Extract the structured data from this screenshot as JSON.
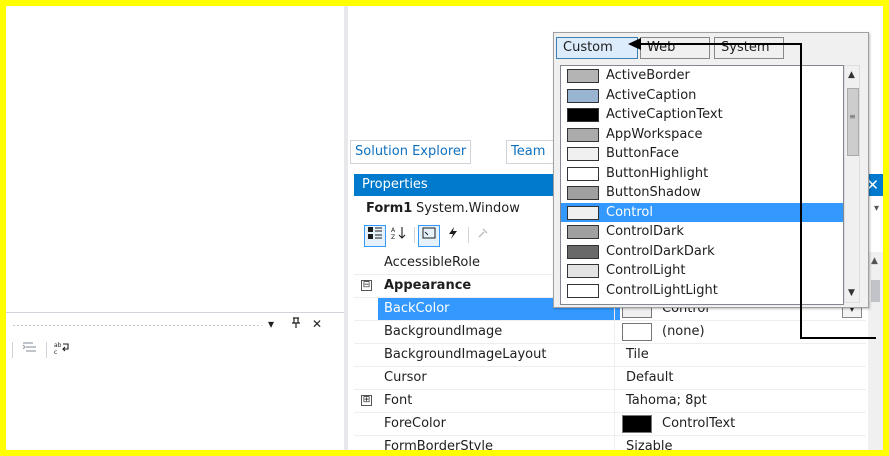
{
  "solution_tabs": {
    "explorer": "Solution Explorer",
    "team": "Team"
  },
  "bottom_panel": {
    "pin": "ꟷ",
    "auto_hide": "ʭ",
    "close": "✕",
    "dropdown": "▾"
  },
  "properties": {
    "title": "Properties",
    "object_name": "Form1",
    "object_type": "System.Window",
    "rows": [
      {
        "name": "AccessibleRole",
        "value": ""
      },
      {
        "name": "Appearance",
        "value": "",
        "category": true,
        "expander": "⊟"
      },
      {
        "name": "BackColor",
        "value": "Control",
        "swatch": "#f0f0f0",
        "selected": true
      },
      {
        "name": "BackgroundImage",
        "value": "(none)",
        "swatch": "#ffffff"
      },
      {
        "name": "BackgroundImageLayout",
        "value": "Tile"
      },
      {
        "name": "Cursor",
        "value": "Default"
      },
      {
        "name": "Font",
        "value": "Tahoma; 8pt",
        "expander": "⊞"
      },
      {
        "name": "ForeColor",
        "value": "ControlText",
        "swatch": "#000000"
      },
      {
        "name": "FormBorderStyle",
        "value": "Sizable"
      }
    ]
  },
  "color_picker": {
    "tabs": [
      "Custom",
      "Web",
      "System"
    ],
    "active_tab": "Custom",
    "items": [
      {
        "label": "ActiveBorder",
        "color": "#b4b4b4"
      },
      {
        "label": "ActiveCaption",
        "color": "#99b4d1"
      },
      {
        "label": "ActiveCaptionText",
        "color": "#000000"
      },
      {
        "label": "AppWorkspace",
        "color": "#ababab"
      },
      {
        "label": "ButtonFace",
        "color": "#f0f0f0"
      },
      {
        "label": "ButtonHighlight",
        "color": "#ffffff"
      },
      {
        "label": "ButtonShadow",
        "color": "#a0a0a0"
      },
      {
        "label": "Control",
        "color": "#f0f0f0",
        "selected": true
      },
      {
        "label": "ControlDark",
        "color": "#a0a0a0"
      },
      {
        "label": "ControlDarkDark",
        "color": "#696969"
      },
      {
        "label": "ControlLight",
        "color": "#e3e3e3"
      },
      {
        "label": "ControlLightLight",
        "color": "#ffffff"
      }
    ]
  },
  "colors": {
    "border": "#ffff00",
    "accent": "#007acc",
    "selection": "#3399ff"
  }
}
